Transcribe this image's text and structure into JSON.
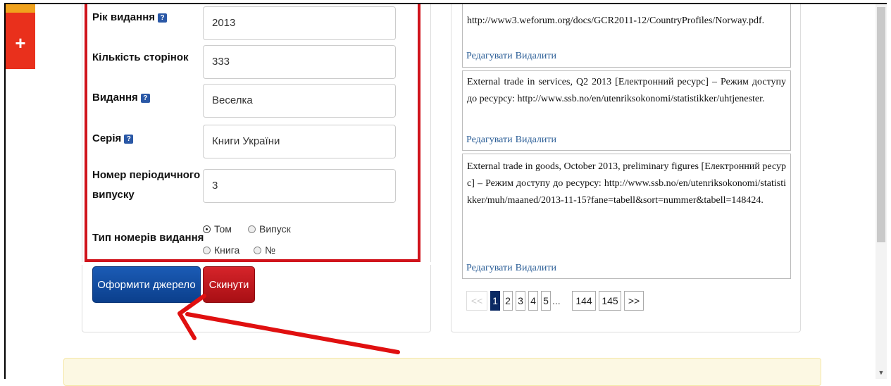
{
  "form": {
    "year_label": "Рік видання",
    "year_value": "2013",
    "pages_label": "Кількість сторінок",
    "pages_value": "333",
    "publisher_label": "Видання",
    "publisher_value": "Веселка",
    "series_label": "Серія",
    "series_value": "Книги України",
    "issue_label_line1": "Номер періодичного",
    "issue_label_line2": "випуску",
    "issue_value": "3",
    "number_type_label": "Тип номерів видання",
    "radio_options": [
      "Том",
      "Випуск",
      "Книга",
      "№"
    ],
    "radio_selected": "Том",
    "help_glyph": "?"
  },
  "buttons": {
    "submit_label": "Оформити джерело",
    "reset_label": "Скинути"
  },
  "entries": [
    {
      "text": "http://www3.weforum.org/docs/GCR2011-12/CountryProfiles/Norway.pdf.",
      "edit": "Редагувати",
      "delete": "Видалити"
    },
    {
      "text": "External trade in services, Q2 2013 [Електронний ресурс] – Режим доступу до ресурсу: http://www.ssb.no/en/utenriksokonomi/statistikker/uhtjenester.",
      "edit": "Редагувати",
      "delete": "Видалити"
    },
    {
      "text": "External trade in goods, October 2013, preliminary figures [Електронний ресурс] – Режим доступу до ресурсу: http://www.ssb.no/en/utenriksokonomi/statistikker/muh/maaned/2013-11-15?fane=tabell&sort=nummer&tabell=148424.",
      "edit": "Редагувати",
      "delete": "Видалити"
    }
  ],
  "pagination": {
    "prev": "<<",
    "pages": [
      "1",
      "2",
      "3",
      "4",
      "5"
    ],
    "ellipsis": "...",
    "tail_pages": [
      "144",
      "145"
    ],
    "next": ">>",
    "current": "1"
  },
  "colors": {
    "highlight_border": "#d0141c",
    "primary_button": "#0b3f8c",
    "danger_button": "#a80f14",
    "link": "#2a5d96",
    "notice_bg": "#fcf8e3",
    "side_tab": "#e9301c"
  },
  "icons": {
    "side_tab": "plus-icon",
    "scroll_down": "triangle-down-icon"
  }
}
